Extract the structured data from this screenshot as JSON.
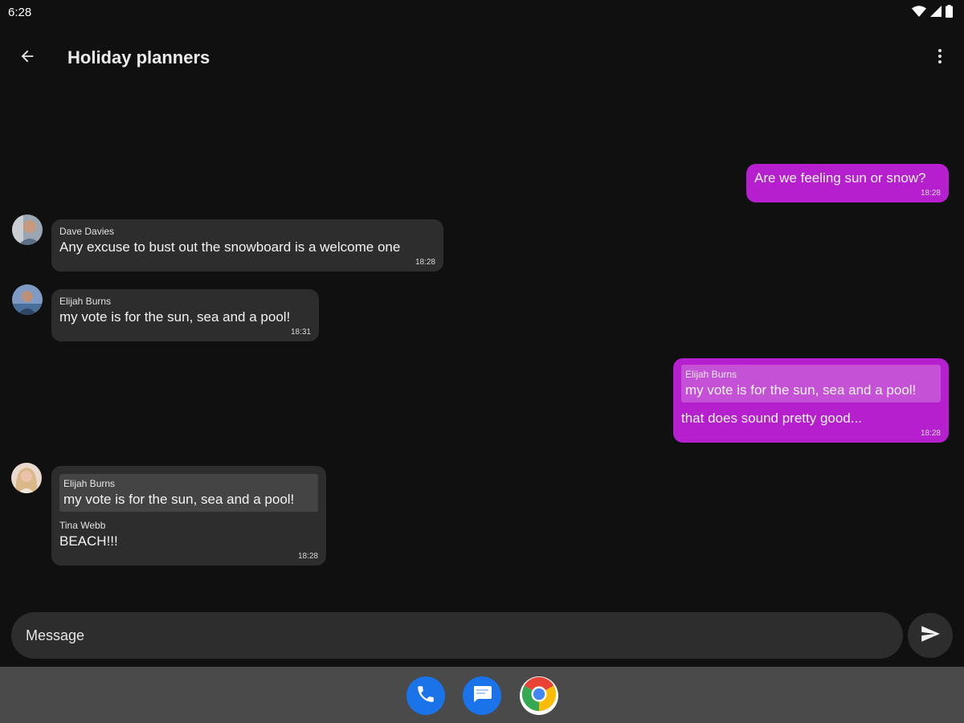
{
  "status_bar": {
    "time": "6:28"
  },
  "app_bar": {
    "title": "Holiday planners"
  },
  "messages": [
    {
      "direction": "out",
      "text": "Are we feeling sun or snow?",
      "time": "18:28"
    },
    {
      "direction": "in",
      "sender": "Dave Davies",
      "text": "Any excuse to bust out the snowboard is a welcome one",
      "time": "18:28"
    },
    {
      "direction": "in",
      "sender": "Elijah Burns",
      "text": "my vote is for the sun, sea and a pool!",
      "time": "18:31"
    },
    {
      "direction": "out",
      "quote": {
        "sender": "Elijah Burns",
        "text": "my vote is for the sun, sea and a pool!"
      },
      "text": "that does sound pretty good...",
      "time": "18:28"
    },
    {
      "direction": "in",
      "quote": {
        "sender": "Elijah Burns",
        "text": "my vote is for the sun, sea and a pool!"
      },
      "sender": "Tina Webb",
      "text": "BEACH!!!",
      "time": "18:28"
    }
  ],
  "composer": {
    "placeholder": "Message"
  },
  "dock": {
    "apps": [
      "phone-icon",
      "messages-icon",
      "chrome-icon"
    ]
  },
  "colors": {
    "background": "#101010",
    "incoming_bubble": "#2d2d2d",
    "outgoing_bubble": "#b51fcd",
    "dock": "#4a4a4a"
  }
}
